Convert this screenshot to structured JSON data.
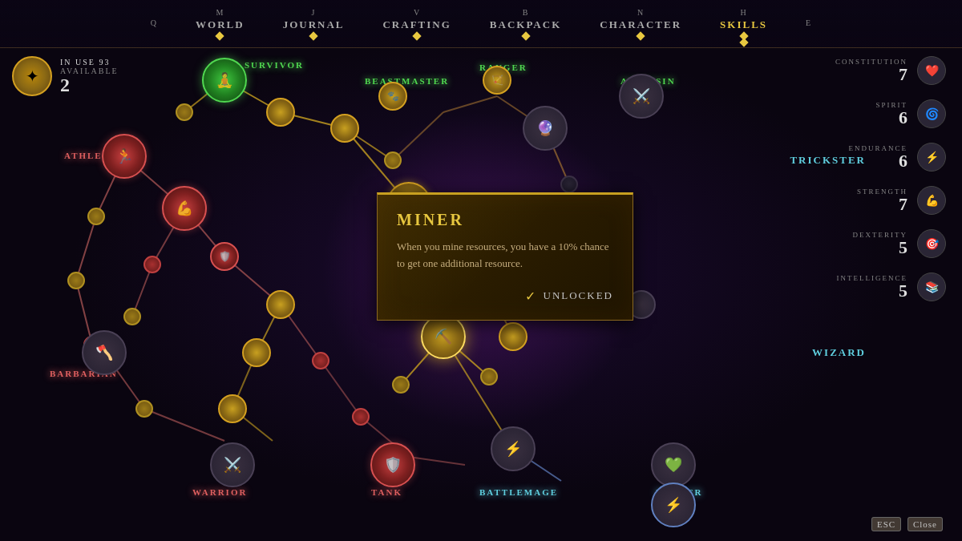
{
  "nav": {
    "items": [
      {
        "key": "Q",
        "label": ""
      },
      {
        "key": "M",
        "label": "WORLD"
      },
      {
        "key": "J",
        "label": "JOURNAL"
      },
      {
        "key": "V",
        "label": "CRAFTING"
      },
      {
        "key": "B",
        "label": "BACKPACK"
      },
      {
        "key": "N",
        "label": "CHARACTER"
      },
      {
        "key": "H",
        "label": "SKILLS",
        "active": true
      },
      {
        "key": "E",
        "label": ""
      }
    ]
  },
  "skill_points": {
    "in_use_label": "IN USE",
    "in_use_value": "93",
    "available_label": "AVAILABLE",
    "available_value": "2"
  },
  "stats": [
    {
      "name": "CONSTITUTION",
      "value": "7"
    },
    {
      "name": "SPIRIT",
      "value": "6"
    },
    {
      "name": "ENDURANCE",
      "value": "6"
    },
    {
      "name": "STRENGTH",
      "value": "7"
    },
    {
      "name": "DEXTERITY",
      "value": "5"
    },
    {
      "name": "INTELLIGENCE",
      "value": "5"
    }
  ],
  "classes": {
    "survivor": "SURVIVOR",
    "beastmaster": "BEASTMASTER",
    "ranger": "RANGER",
    "assassin": "ASSASSIN",
    "athlete": "ATHLETE",
    "barbarian": "BARBARIAN",
    "warrior": "WARRIOR",
    "tank": "TANK",
    "battlemage": "BATTLEMAGE",
    "healer": "HEALER",
    "trickster": "TRICKSTER",
    "wizard": "WIZARD"
  },
  "tooltip": {
    "title": "MINER",
    "description": "When you mine resources, you have a 10% chance to get one additional resource.",
    "status": "UNLOCKED",
    "check": "✓"
  },
  "close_hint": {
    "key": "ESC",
    "label": "Close"
  }
}
